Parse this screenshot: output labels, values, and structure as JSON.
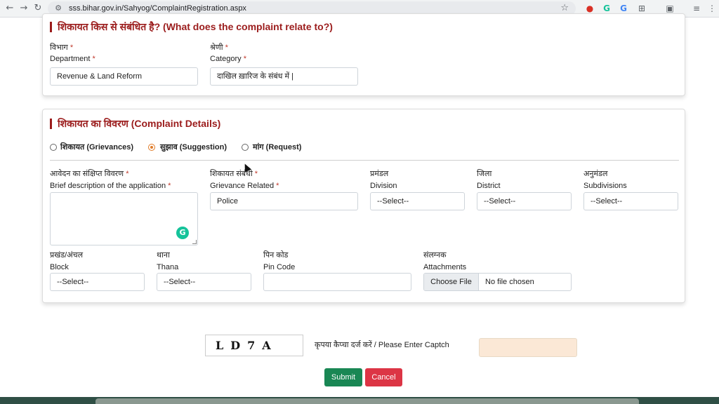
{
  "browser": {
    "url": "sss.bihar.gov.in/Sahyog/ComplaintRegistration.aspx",
    "back_icon": "←",
    "forward_icon": "→",
    "reload_icon": "↻",
    "site_info_icon": "⚙",
    "star_icon": "☆",
    "extension_icons": [
      "●",
      "G",
      "G",
      "⊞",
      "▣",
      "≡",
      "⋮"
    ]
  },
  "section1": {
    "title": "शिकायत किस से संबंधित है? (What does the complaint relate to?)",
    "department": {
      "label_hi": "विभाग",
      "label_en": "Department",
      "required": "*",
      "value": "Revenue & Land Reform"
    },
    "category": {
      "label_hi": "श्रेणी",
      "label_en": "Category",
      "required": "*",
      "value": "दाखिल ख़ारिज के संबंध में |"
    }
  },
  "section2": {
    "title": "शिकायत का विवरण (Complaint Details)",
    "radios": [
      {
        "label": "शिकायत (Grievances)",
        "checked": false
      },
      {
        "label": "सुझाव (Suggestion)",
        "checked": true
      },
      {
        "label": "मांग (Request)",
        "checked": false
      }
    ],
    "brief": {
      "label_hi": "आवेदन का संक्षिप्त विवरण",
      "label_en": "Brief description of the application",
      "required": "*",
      "value": ""
    },
    "grievance": {
      "label_hi": "शिकायत संबंधी",
      "label_en": "Grievance Related",
      "required": "*",
      "value": "Police"
    },
    "division": {
      "label_hi": "प्रमंडल",
      "label_en": "Division",
      "value": "--Select--"
    },
    "district": {
      "label_hi": "जिला",
      "label_en": "District",
      "value": "--Select--"
    },
    "subdivision": {
      "label_hi": "अनुमंडल",
      "label_en": "Subdivisions",
      "value": "--Select--"
    },
    "block": {
      "label_hi": "प्रखंड/अंचल",
      "label_en": "Block",
      "value": "--Select--"
    },
    "thana": {
      "label_hi": "थाना",
      "label_en": "Thana",
      "value": "--Select--"
    },
    "pincode": {
      "label_hi": "पिन कोड",
      "label_en": "Pin Code",
      "value": ""
    },
    "attachments": {
      "label_hi": "संलग्नक",
      "label_en": "Attachments",
      "button": "Choose File",
      "status": "No file chosen"
    }
  },
  "captcha": {
    "code": "LD7A",
    "label": "कृपया कैप्चा दर्ज करें / Please Enter Captch",
    "value": ""
  },
  "actions": {
    "submit": "Submit",
    "cancel": "Cancel"
  },
  "colors": {
    "section_title": "#9b1c1c",
    "required": "#c0392b",
    "submit": "#198754",
    "cancel": "#dc3545",
    "radio_checked": "#e07b28",
    "captcha_input_bg": "#fbe8d6"
  }
}
